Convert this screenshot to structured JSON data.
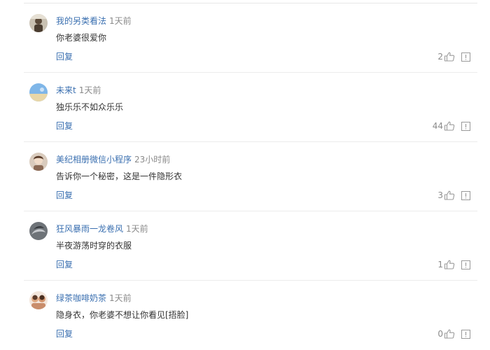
{
  "comments": [
    {
      "user": "我的另类看法",
      "time": "1天前",
      "content": "你老婆很爱你",
      "reply_label": "回复",
      "likes": "2"
    },
    {
      "user": "未来t",
      "time": "1天前",
      "content": "独乐乐不如众乐乐",
      "reply_label": "回复",
      "likes": "44"
    },
    {
      "user": "美纪相册微信小程序",
      "time": "23小时前",
      "content": "告诉你一个秘密，这是一件隐形衣",
      "reply_label": "回复",
      "likes": "3"
    },
    {
      "user": "狂风暴雨一龙卷风",
      "time": "1天前",
      "content": "半夜游荡时穿的衣服",
      "reply_label": "回复",
      "likes": "1"
    },
    {
      "user": "绿茶咖啡奶茶",
      "time": "1天前",
      "content": "隐身衣，你老婆不想让你看见[捂脸]",
      "reply_label": "回复",
      "likes": "0"
    }
  ],
  "icons": {
    "like": "thumbs-up-icon",
    "report": "report-icon"
  },
  "colors": {
    "username": "#3a6fb0",
    "reply": "#3a6fb0",
    "meta": "#8a8a8a",
    "text": "#333333"
  }
}
